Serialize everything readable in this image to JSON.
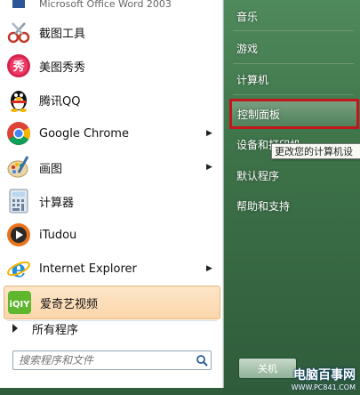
{
  "left_menu": {
    "top_partial": "Microsoft Office Word 2003",
    "items": [
      {
        "label": "截图工具",
        "icon": "scissors-icon",
        "has_arrow": false
      },
      {
        "label": "美图秀秀",
        "icon": "meitu-icon",
        "has_arrow": false
      },
      {
        "label": "腾讯QQ",
        "icon": "qq-penguin-icon",
        "has_arrow": false
      },
      {
        "label": "Google Chrome",
        "icon": "chrome-icon",
        "has_arrow": true
      },
      {
        "label": "画图",
        "icon": "paint-icon",
        "has_arrow": true
      },
      {
        "label": "计算器",
        "icon": "calculator-icon",
        "has_arrow": false
      },
      {
        "label": "iTudou",
        "icon": "itudou-icon",
        "has_arrow": false
      },
      {
        "label": "Internet Explorer",
        "icon": "ie-icon",
        "has_arrow": true
      },
      {
        "label": "爱奇艺视频",
        "icon": "iqiyi-icon",
        "has_arrow": false
      }
    ],
    "all_programs": "所有程序",
    "search_placeholder": "搜索程序和文件"
  },
  "right_menu": {
    "items": [
      {
        "label": "音乐"
      },
      {
        "label": "游戏"
      },
      {
        "label": "计算机"
      },
      {
        "label": "控制面板"
      },
      {
        "label": "设备和打印机"
      },
      {
        "label": "默认程序"
      },
      {
        "label": "帮助和支持"
      }
    ],
    "selected_index": 3,
    "tooltip": "更改您的计算机设",
    "shutdown_label": "关机"
  },
  "watermark": {
    "main": "电脑百事网",
    "sub": "WWW.PC841.COM"
  },
  "colors": {
    "highlight_border": "#c2161c",
    "selected_program_bg": "#fbd6ab"
  }
}
